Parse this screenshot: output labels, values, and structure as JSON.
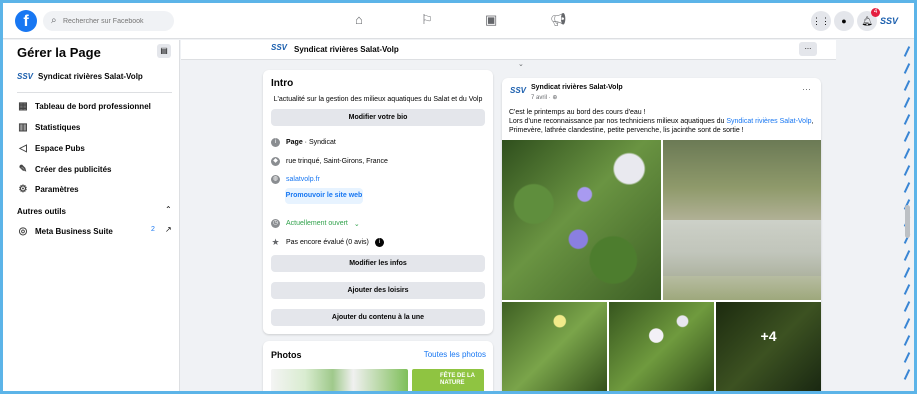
{
  "topbar": {
    "logo": "f",
    "search_placeholder": "Rechercher sur Facebook",
    "nav_icons": [
      "home-icon",
      "flag-icon",
      "ads-icon",
      "megaphone-icon"
    ],
    "right_icons": [
      "grid-menu-icon",
      "messenger-icon",
      "bell-icon"
    ],
    "notification_count": "4",
    "avatar_text": "SSV"
  },
  "sidebar": {
    "title": "Gérer la Page",
    "page_name": "Syndicat rivières Salat-Volp",
    "items": [
      {
        "label": "Tableau de bord professionnel",
        "icon": "dashboard-icon"
      },
      {
        "label": "Statistiques",
        "icon": "stats-icon"
      },
      {
        "label": "Espace Pubs",
        "icon": "megaphone-icon"
      },
      {
        "label": "Créer des publicités",
        "icon": "edit-icon"
      },
      {
        "label": "Paramètres",
        "icon": "gear-icon"
      }
    ],
    "section_title": "Autres outils",
    "meta_item": {
      "label": "Meta Business Suite",
      "count": "2"
    }
  },
  "page_header": {
    "name": "Syndicat rivières Salat-Volp",
    "more": "..."
  },
  "intro": {
    "title": "Intro",
    "bio": "L'actualité sur la gestion des milieux aquatiques du Salat et du Volp",
    "edit_bio": "Modifier votre bio",
    "category_prefix": "Page",
    "category": " · Syndicat",
    "address": "rue trinqué, Saint-Girons, France",
    "website": "salatvolp.fr",
    "promote": "Promouvoir le site web",
    "open_status": "Actuellement ouvert",
    "open_chevron": "⌄",
    "rating": "Pas encore évalué (0 avis)",
    "edit_info": "Modifier les infos",
    "add_hobbies": "Ajouter des loisirs",
    "add_featured": "Ajouter du contenu à la une"
  },
  "photos": {
    "title": "Photos",
    "all": "Toutes les photos",
    "thumb2_text": "FÊTE DE LA NATURE"
  },
  "post": {
    "author": "Syndicat rivières Salat-Volp",
    "time": "7 avril · ",
    "more": "···",
    "text_line1": "C'est le printemps au bord des cours d'eau !",
    "text_line2a": "Lors d'une reconnaissance par nos techniciens milieux aquatiques du ",
    "text_link": "Syndicat rivières Salat-Volp",
    "text_line2b": ",",
    "text_line3": "Primevère, lathrée clandestine, petite pervenche, lis jacinthe sont de sortie !",
    "more_photos": "+4"
  }
}
